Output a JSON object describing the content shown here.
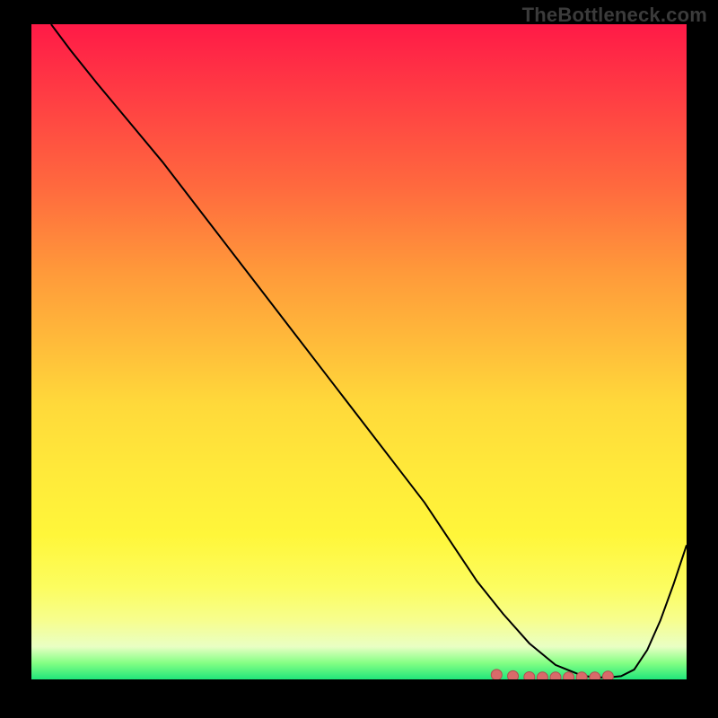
{
  "watermark": "TheBottleneck.com",
  "colors": {
    "curve": "#000000",
    "marker_fill": "#d96a6a",
    "marker_stroke": "#b04f4f"
  },
  "chart_data": {
    "type": "line",
    "title": "",
    "xlabel": "",
    "ylabel": "",
    "xlim": [
      0,
      100
    ],
    "ylim": [
      0,
      100
    ],
    "grid": false,
    "legend": false,
    "series": [
      {
        "name": "bottleneck_curve",
        "x": [
          3,
          6,
          10,
          15,
          20,
          25,
          30,
          35,
          40,
          45,
          50,
          55,
          60,
          62,
          65,
          68,
          72,
          76,
          80,
          84,
          86,
          88,
          90,
          92,
          94,
          96,
          98,
          100
        ],
        "y": [
          100,
          96,
          91,
          85,
          79,
          72.5,
          66,
          59.5,
          53,
          46.5,
          40,
          33.5,
          27,
          24,
          19.5,
          15,
          10,
          5.5,
          2.2,
          0.6,
          0.3,
          0.3,
          0.5,
          1.5,
          4.5,
          9,
          14.5,
          20.5
        ]
      }
    ],
    "markers": {
      "name": "minimum_highlight",
      "x": [
        71,
        73.5,
        76,
        78,
        80,
        82,
        84,
        86,
        88
      ],
      "y": [
        0.7,
        0.5,
        0.35,
        0.3,
        0.3,
        0.3,
        0.3,
        0.3,
        0.45
      ],
      "size": 6
    }
  }
}
